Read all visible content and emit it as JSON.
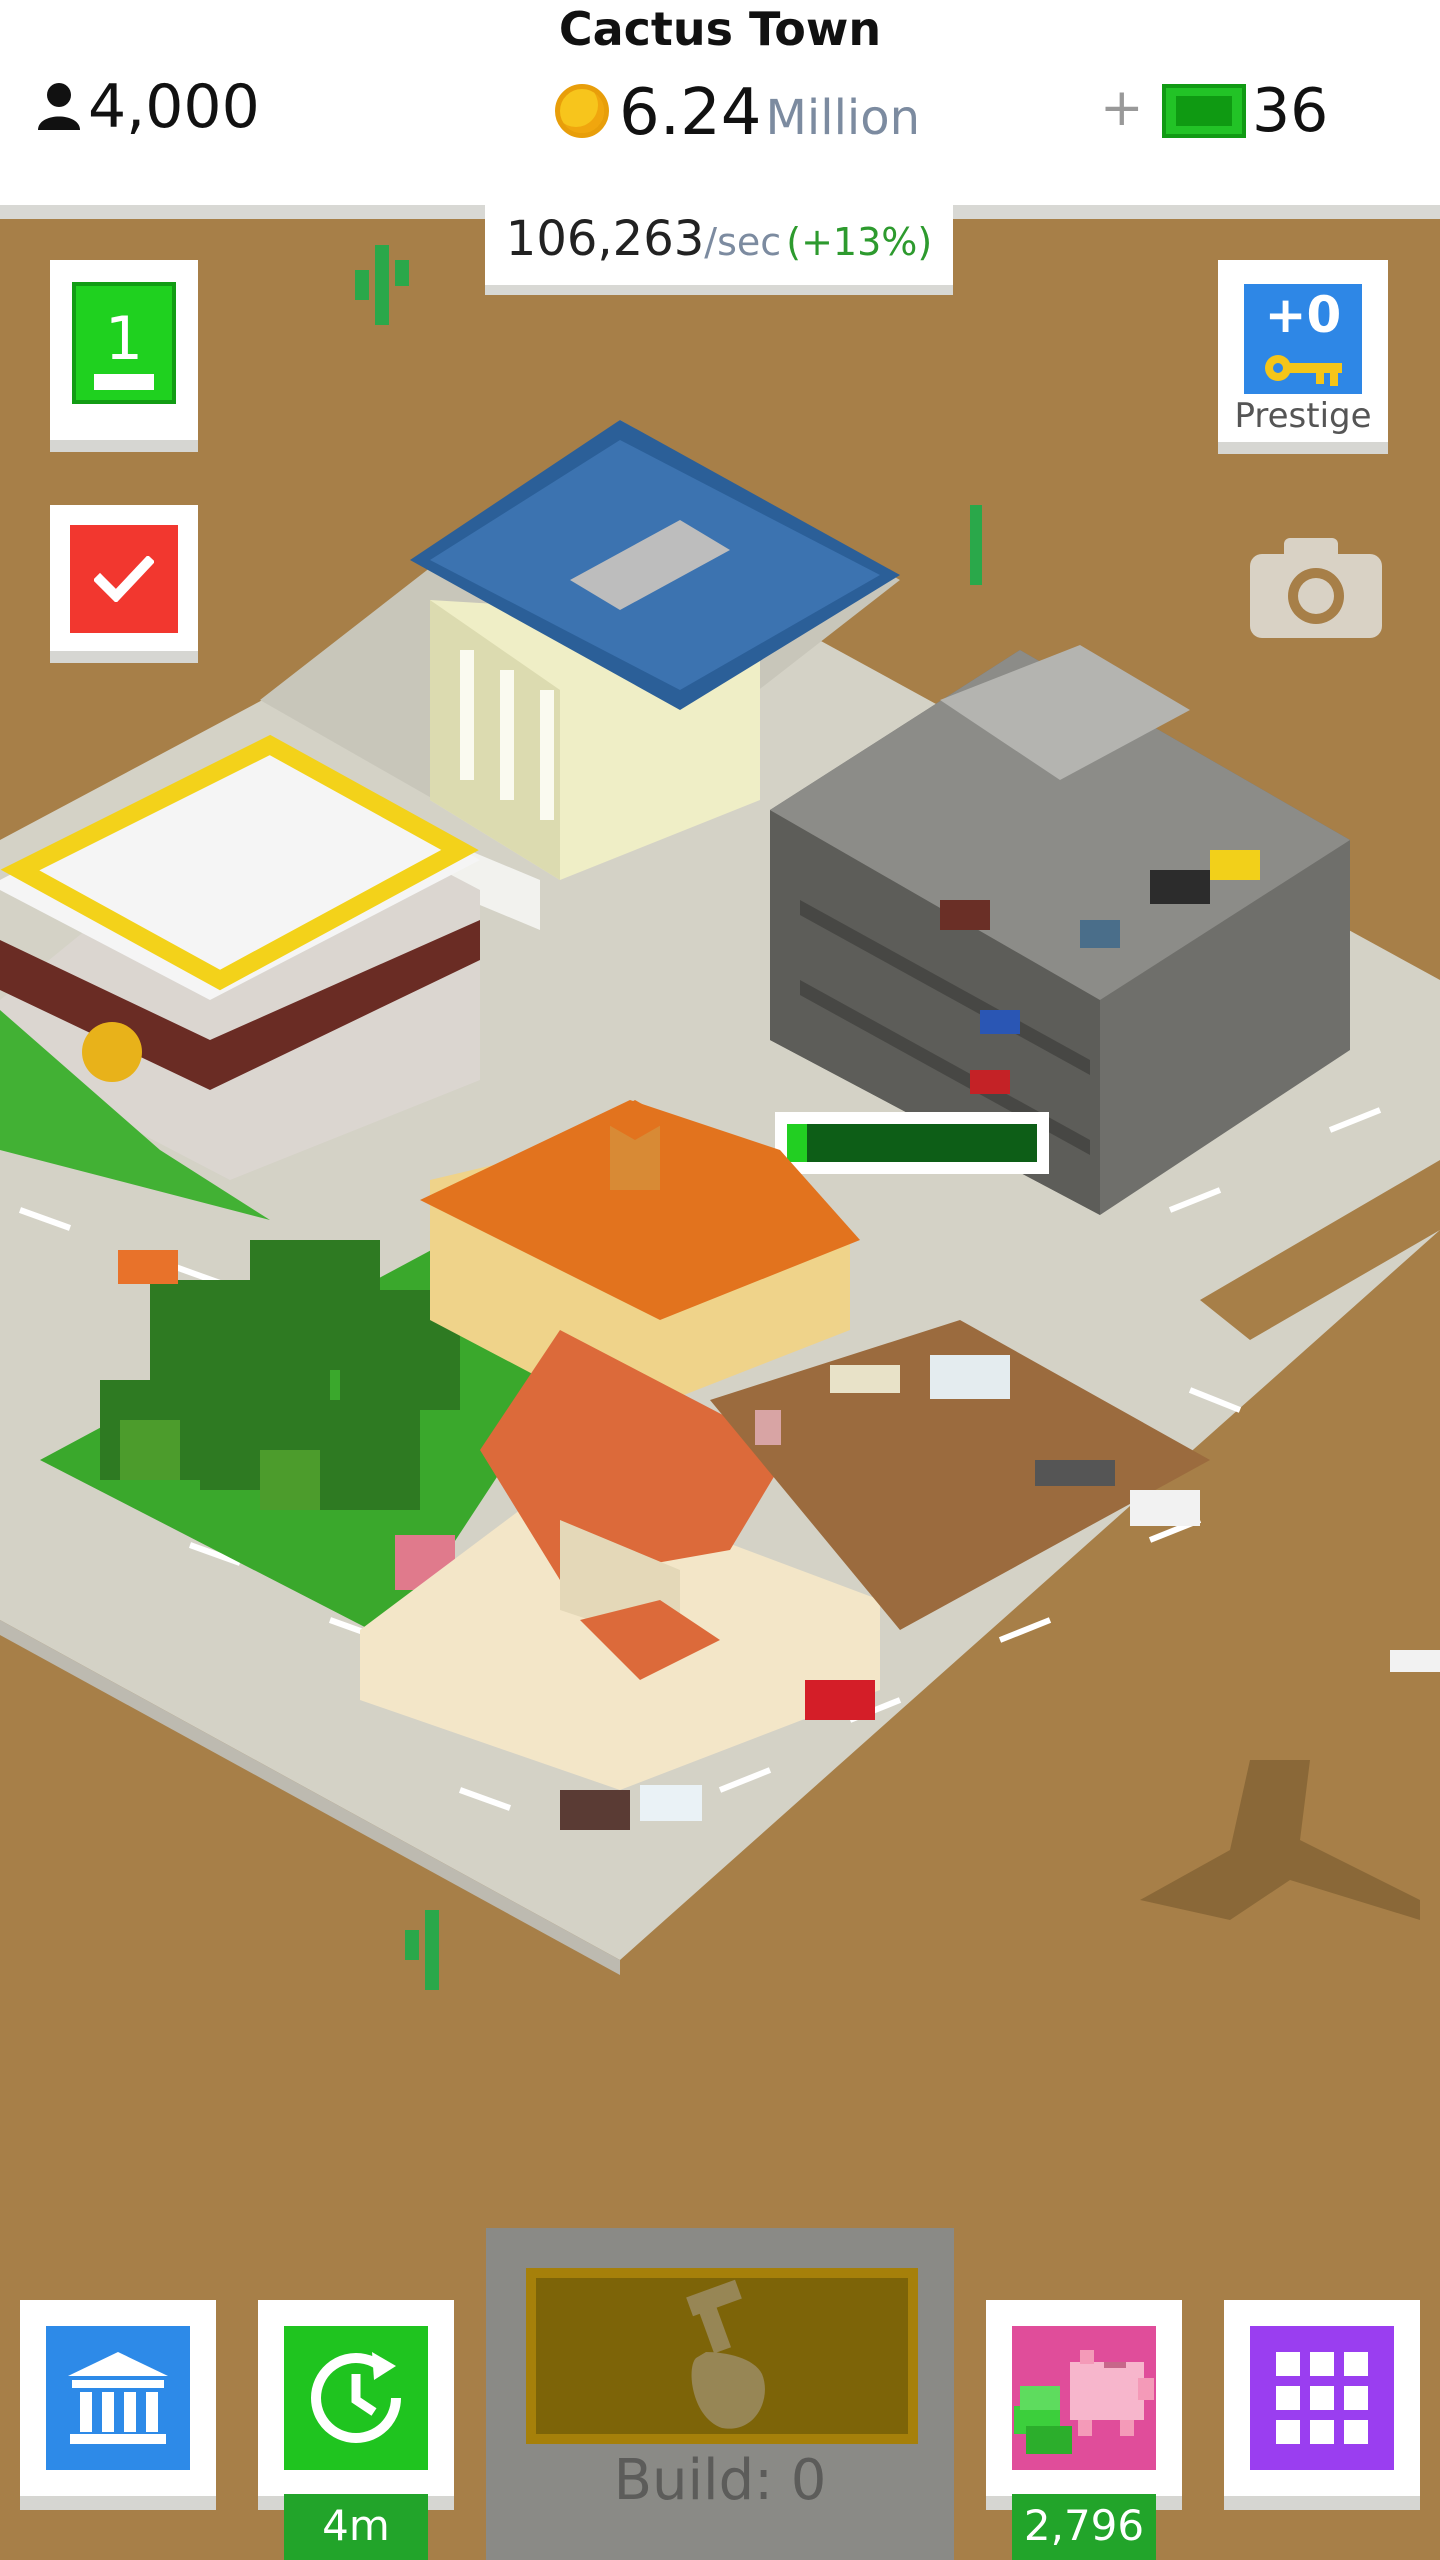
{
  "header": {
    "town_name": "Cactus Town",
    "population": "4,000",
    "money_value": "6.24",
    "money_unit": "Million",
    "plus": "+",
    "cash": "36",
    "income_rate": "106,263",
    "income_unit": "/sec",
    "income_bonus": "(+13%)"
  },
  "level": {
    "number": "1",
    "progress": 0.0
  },
  "prestige": {
    "count": "+0",
    "label": "Prestige"
  },
  "construction": {
    "progress": 0.08
  },
  "bottom": {
    "timer_badge": "4m",
    "piggy_badge": "2,796",
    "build_label": "Build: 0"
  },
  "icons": {
    "population": "person-icon",
    "money": "coin-icon",
    "cash": "cash-bill-icon",
    "tasks": "checkmark-icon",
    "prestige": "key-icon",
    "camera": "camera-icon",
    "bank": "bank-icon",
    "timer": "clock-refresh-icon",
    "piggy": "piggy-bank-icon",
    "grid": "grid-icon",
    "build": "hammer-hand-icon"
  },
  "colors": {
    "ground": "#a77f48",
    "road": "#d4d2c6",
    "accent_green": "#1fd11f",
    "accent_blue": "#2d8ae8",
    "accent_red": "#f2372f",
    "accent_purple": "#9a3ef0"
  }
}
